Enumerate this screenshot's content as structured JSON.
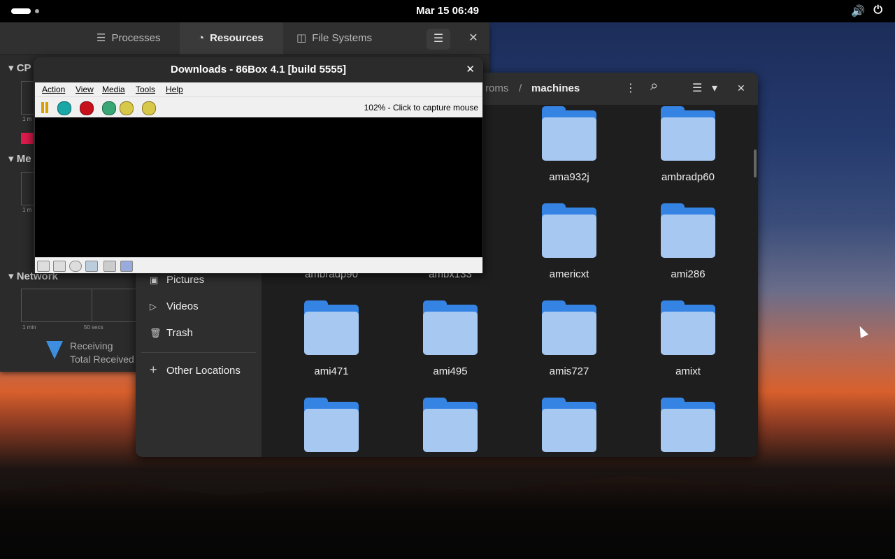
{
  "topbar": {
    "clock": "Mar 15  06:49",
    "volume_icon": "🔊",
    "power_icon": "⏻"
  },
  "sysmon": {
    "tabs": [
      "Processes",
      "Resources",
      "File Systems"
    ],
    "tab_icons": [
      "☰",
      "◔",
      "◫"
    ],
    "menu_icon": "☰",
    "close_icon": "✕",
    "sections": {
      "cpu": "CP",
      "memory": "Me",
      "network": "Network"
    },
    "graph_labels": {
      "a": "1 m",
      "b": "1 m",
      "c": "1 min",
      "d": "50 secs"
    },
    "receiving": "Receiving",
    "total_received": "Total Received"
  },
  "files": {
    "path": [
      "roms",
      "/",
      "machines"
    ],
    "sidebar": [
      {
        "icon": "▣",
        "label": "Pictures"
      },
      {
        "icon": "▷",
        "label": "Videos"
      },
      {
        "icon": "🗑",
        "label": "Trash"
      },
      {
        "icon": "+",
        "label": "Other Locations"
      }
    ],
    "folders_row1": [
      "ama932j",
      "ambradp60"
    ],
    "folders_row2_partial": [
      "ambradp90",
      "ambx133"
    ],
    "folders_row2": [
      "americxt",
      "ami286"
    ],
    "folders_row3": [
      "ami471",
      "ami495",
      "amis727",
      "amixt"
    ],
    "search_icon": "⌕",
    "list_icon": "☰",
    "dropdown_icon": "▾",
    "more_icon": "⋮",
    "close_icon": "✕"
  },
  "box86": {
    "title": "Downloads - 86Box 4.1 [build 5555]",
    "close_icon": "✕",
    "menu": [
      "Action",
      "View",
      "Media",
      "Tools",
      "Help"
    ],
    "status": "102% - Click to capture mouse"
  }
}
